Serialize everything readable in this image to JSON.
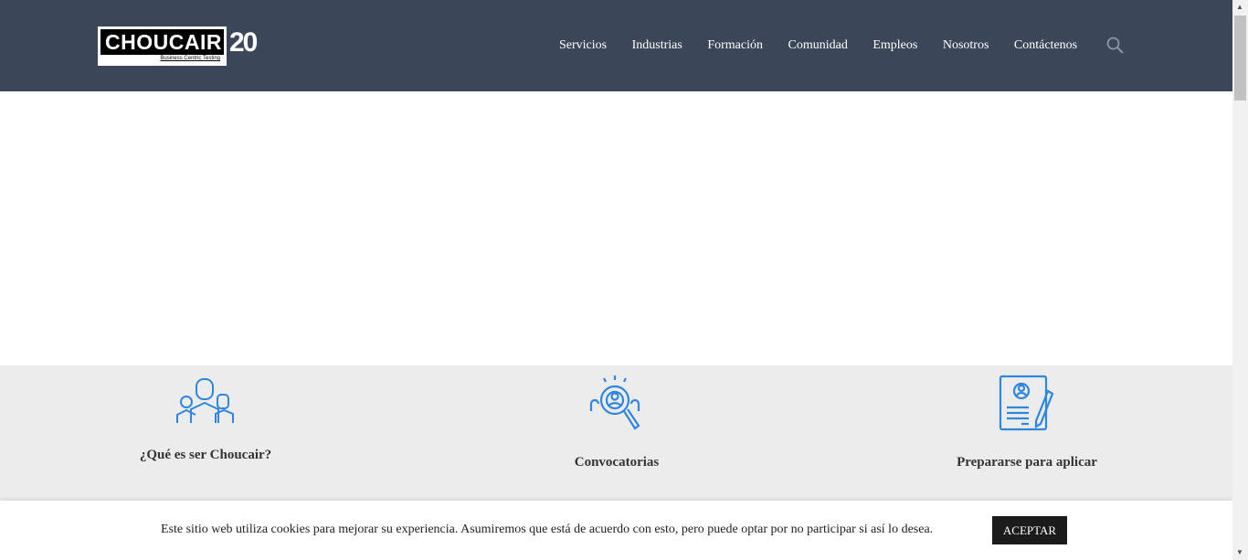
{
  "header": {
    "logo_text": "CHOUCAIR",
    "logo_tagline": "Business Centric Testing",
    "anniversary": "20",
    "nav": [
      "Servicios",
      "Industrias",
      "Formación",
      "Comunidad",
      "Empleos",
      "Nosotros",
      "Contáctenos"
    ]
  },
  "features": [
    {
      "title": "¿Qué es ser Choucair?",
      "icon": "team-icon"
    },
    {
      "title": "Convocatorias",
      "icon": "search-people-icon"
    },
    {
      "title": "Prepararse para aplicar",
      "icon": "resume-pen-icon"
    }
  ],
  "cookie": {
    "text": "Este sitio web utiliza cookies para mejorar su experiencia. Asumiremos que está de acuerdo con esto, pero puede optar por no participar si así lo desea.",
    "accept": "ACEPTAR"
  },
  "colors": {
    "header": "#3b4759",
    "icon": "#2f86e0",
    "band": "#ececec"
  }
}
